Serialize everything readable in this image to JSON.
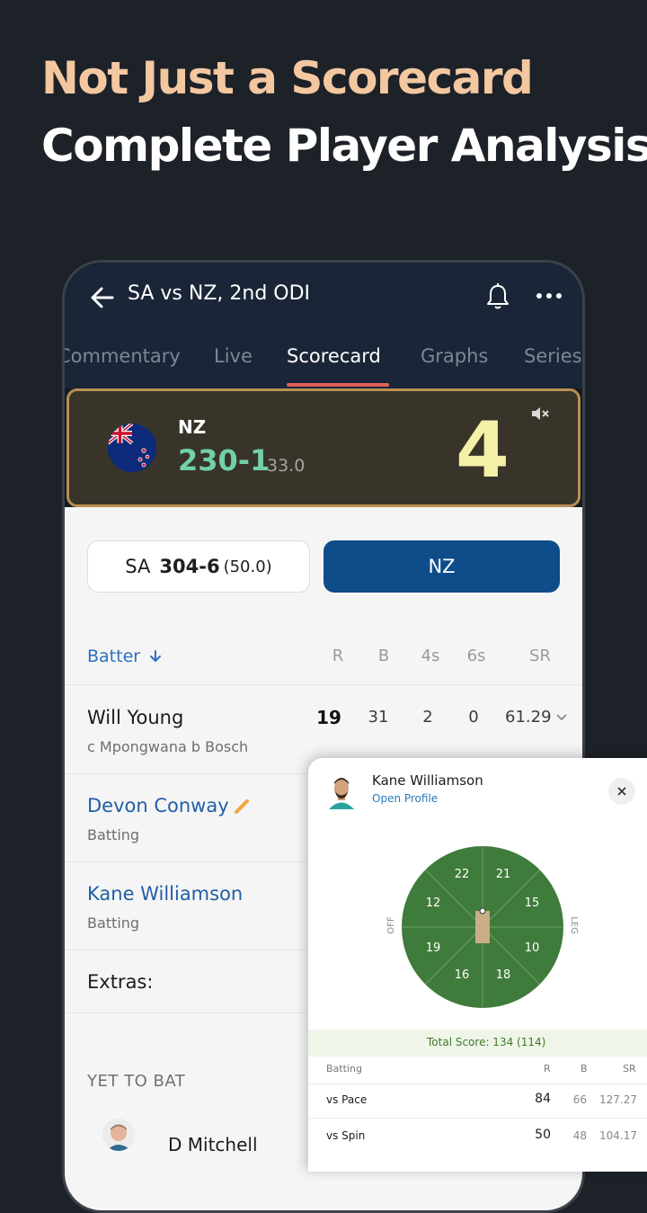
{
  "headline": {
    "line1": "Not Just a Scorecard",
    "line2": "Complete Player Analysis!",
    "line1_color": "#f3c7a0"
  },
  "appbar": {
    "title": "SA vs NZ, 2nd ODI",
    "icons": [
      "back-arrow-icon",
      "bell-icon",
      "more-dots-icon"
    ]
  },
  "tabs": [
    {
      "label": "Commentary"
    },
    {
      "label": "Live"
    },
    {
      "label": "Scorecard",
      "active": true
    },
    {
      "label": "Graphs"
    },
    {
      "label": "Series"
    }
  ],
  "live_score": {
    "team": "NZ",
    "score": "230-1",
    "overs": "33.0",
    "last_ball": "4",
    "score_color": "#72d1a7",
    "icons": [
      "nz-flag-icon",
      "mute-icon"
    ]
  },
  "innings_toggle": {
    "sa": {
      "team": "SA",
      "score": "304-6",
      "overs": "(50.0)"
    },
    "nz": {
      "team": "NZ",
      "active": true,
      "color": "#0f4c8a"
    }
  },
  "batting_table": {
    "header": "Batter",
    "columns": [
      "R",
      "B",
      "4s",
      "6s",
      "SR"
    ],
    "rows": [
      {
        "name": "Will Young",
        "dismissal": "c Mpongwana b Bosch",
        "r": "19",
        "b": "31",
        "fours": "2",
        "sixes": "0",
        "sr": "61.29"
      },
      {
        "name": "Devon Conway",
        "dismissal": "Batting"
      },
      {
        "name": "Kane Williamson",
        "dismissal": "Batting"
      }
    ],
    "extras_label": "Extras:",
    "yet_to_bat_label": "YET TO BAT",
    "yet_to_bat": [
      "D Mitchell"
    ]
  },
  "player_popup": {
    "name": "Kane Williamson",
    "link": "Open Profile",
    "wagon_wheel": {
      "off_label": "OFF",
      "leg_label": "LEG",
      "zones": [
        "22",
        "21",
        "15",
        "10",
        "18",
        "16",
        "19",
        "12"
      ],
      "field_color": "#3f7b3a"
    },
    "total_score": "Total Score: 134 (114)",
    "table": {
      "header": [
        "Batting",
        "R",
        "B",
        "SR"
      ],
      "rows": [
        {
          "label": "vs Pace",
          "r": "84",
          "b": "66",
          "sr": "127.27"
        },
        {
          "label": "vs Spin",
          "r": "50",
          "b": "48",
          "sr": "104.17"
        }
      ]
    }
  }
}
